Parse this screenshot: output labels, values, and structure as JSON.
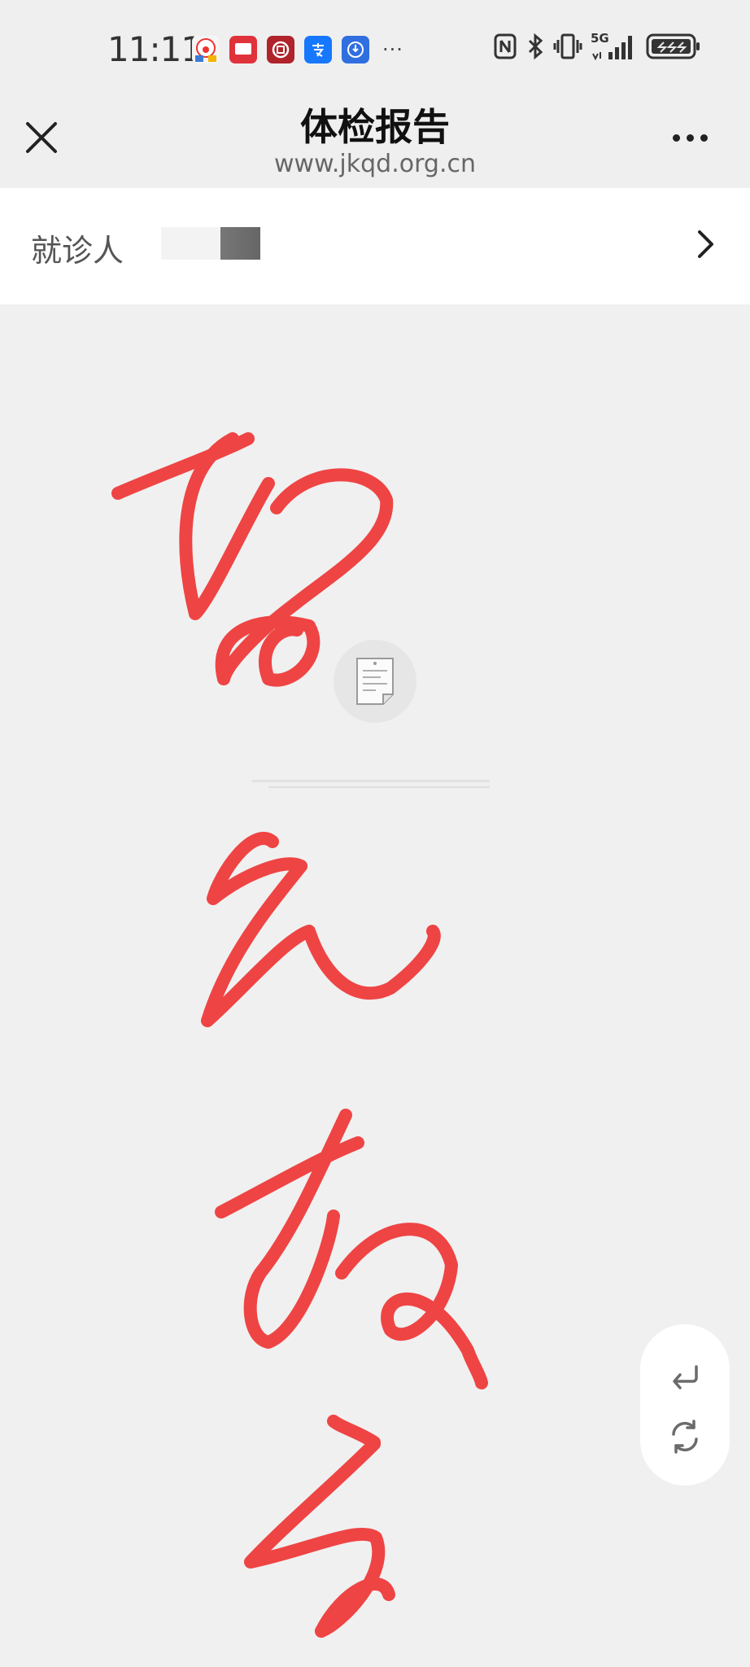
{
  "status_bar": {
    "time": "11:11",
    "more": "···",
    "network": "5G",
    "app_icons": [
      "clown-app-icon",
      "red-square-app-icon",
      "bank-app-icon",
      "alipay-icon",
      "blue-app-icon"
    ],
    "system_icons": [
      "nfc-icon",
      "bluetooth-icon",
      "vibrate-icon",
      "signal-icon",
      "battery-icon"
    ]
  },
  "header": {
    "title": "体检报告",
    "url": "www.jkqd.org.cn"
  },
  "patient": {
    "label": "就诊人"
  },
  "content": {
    "icon": "document-icon",
    "caption_blurred": true
  },
  "fab": {
    "buttons": [
      "return-icon",
      "refresh-icon"
    ]
  },
  "colors": {
    "background": "#f0f0f0",
    "header_bg": "#efefef",
    "card_bg": "#ffffff",
    "scribble": "#ef4444"
  }
}
